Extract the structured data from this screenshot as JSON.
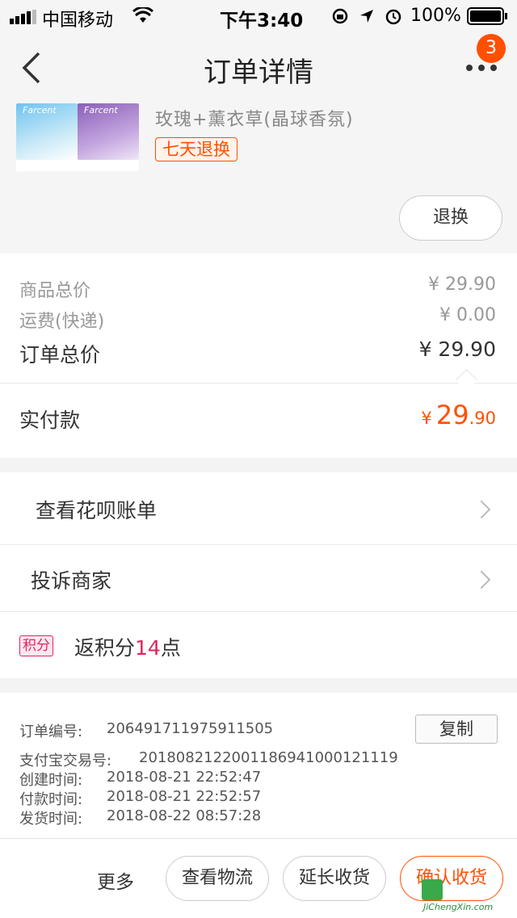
{
  "status_bar": {
    "carrier": "中国移动",
    "time": "下午3:40",
    "battery": "100%",
    "icons": [
      "signal-icon",
      "wifi-icon",
      "rotation-lock-icon",
      "location-icon",
      "alarm-icon",
      "battery-icon"
    ]
  },
  "nav": {
    "title": "订单详情",
    "back_icon": "back-arrow-icon",
    "more_icon": "more-dots-icon",
    "badge_count": "3"
  },
  "product": {
    "variant": "玫瑰+薰衣草(晶球香氛)",
    "tag": "七天退换",
    "refund_button": "退换",
    "image_brand": "Farcent"
  },
  "prices": {
    "items_label": "商品总价",
    "items_value": "¥ 29.90",
    "shipping_label": "运费(快递)",
    "shipping_value": "¥ 0.00",
    "total_label": "订单总价",
    "total_value": "¥ 29.90"
  },
  "paid": {
    "label": "实付款",
    "currency": "¥",
    "integer": "29",
    "decimal": ".90",
    "accent_color": "#ff5000"
  },
  "rows": {
    "huabei": "查看花呗账单",
    "complain": "投诉商家",
    "points_badge": "积分",
    "points_text": "返积分",
    "points_count": "14",
    "points_unit": "点"
  },
  "info": {
    "order_no_label": "订单编号:",
    "order_no": "206491711975911505",
    "copy_button": "复制",
    "alipay_label": "支付宝交易号:",
    "alipay_no": "2018082122001186941000121119",
    "created_label": "创建时间:",
    "created": "2018-08-21 22:52:47",
    "paid_label": "付款时间:",
    "paid_time": "2018-08-21 22:52:57",
    "shipped_label": "发货时间:",
    "shipped": "2018-08-22 08:57:28"
  },
  "bottom_bar": {
    "more": "更多",
    "logistics": "查看物流",
    "extend": "延长收货",
    "confirm": "确认收货"
  },
  "watermark": {
    "text": "JiChengXin.com"
  }
}
